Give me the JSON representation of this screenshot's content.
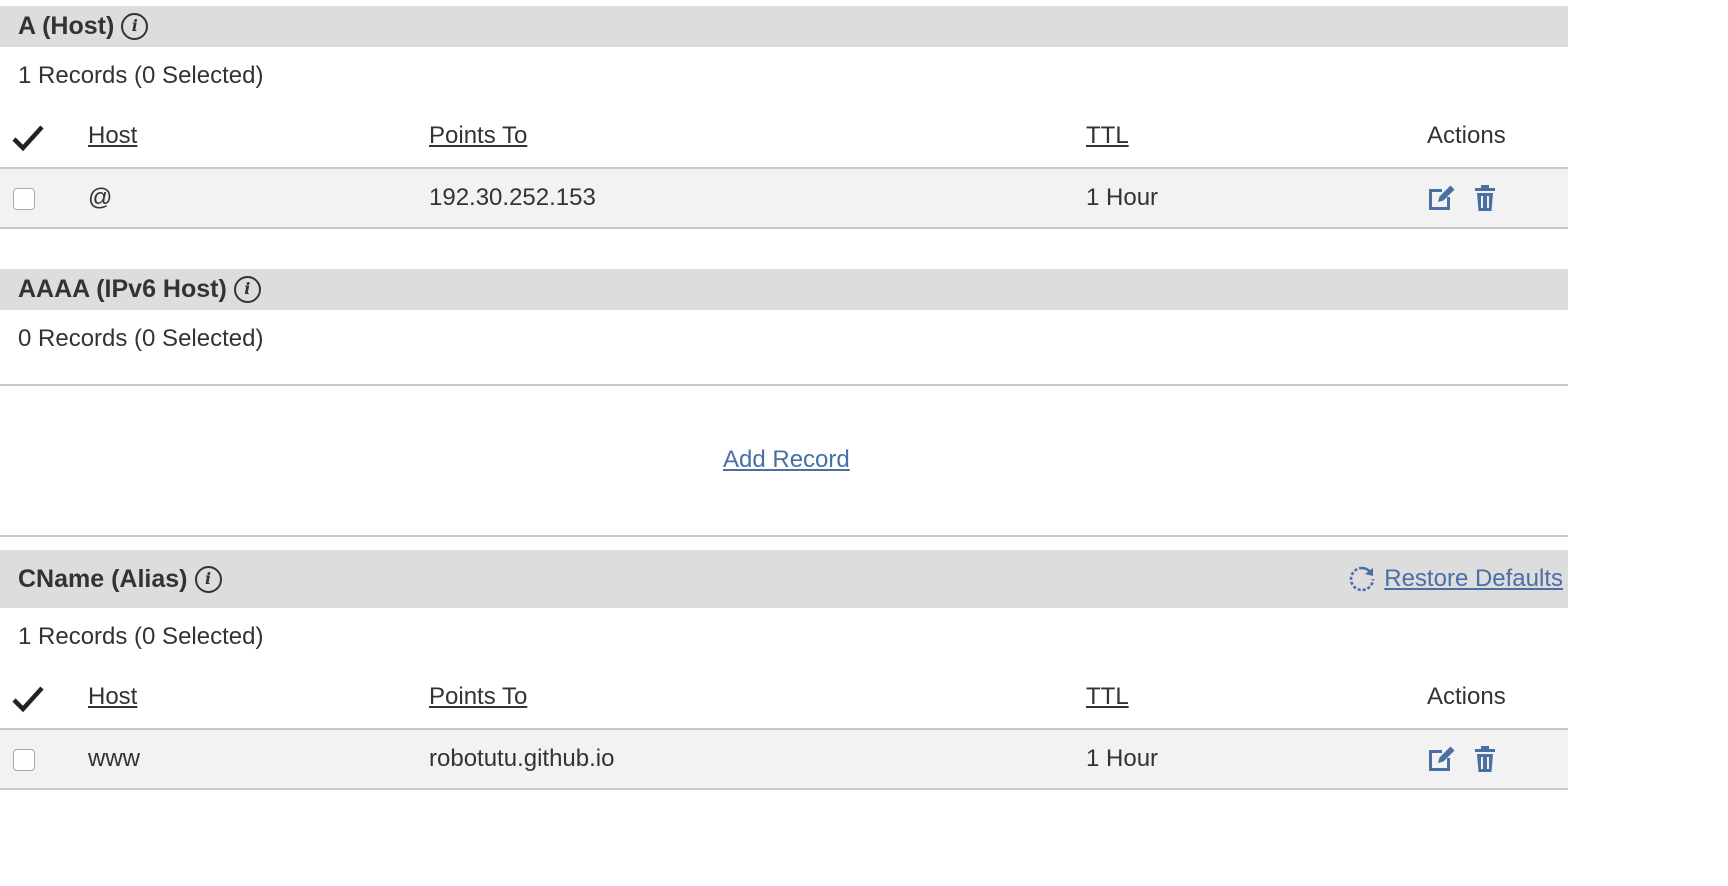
{
  "sections": [
    {
      "title": "A (Host)",
      "count_text": "1 Records (0 Selected)",
      "columns": {
        "host": "Host",
        "points_to": "Points To",
        "ttl": "TTL",
        "actions": "Actions"
      },
      "rows": [
        {
          "host": "@",
          "points_to": "192.30.252.153",
          "ttl": "1 Hour"
        }
      ]
    },
    {
      "title": "AAAA (IPv6 Host)",
      "count_text": "0 Records (0 Selected)",
      "add_record_label": "Add Record"
    },
    {
      "title": "CName (Alias)",
      "restore_label": "Restore Defaults",
      "count_text": "1 Records (0 Selected)",
      "columns": {
        "host": "Host",
        "points_to": "Points To",
        "ttl": "TTL",
        "actions": "Actions"
      },
      "rows": [
        {
          "host": "www",
          "points_to": "robotutu.github.io",
          "ttl": "1 Hour"
        }
      ]
    }
  ],
  "colors": {
    "link": "#4a6fa5",
    "icon_blue": "#4a6fa5",
    "header_bg": "#dddddd",
    "row_bg": "#f2f2f2"
  },
  "icons": {
    "info": "info-icon",
    "edit": "edit-icon",
    "delete": "trash-icon",
    "refresh": "refresh-icon",
    "select_all": "checkmark-icon"
  }
}
